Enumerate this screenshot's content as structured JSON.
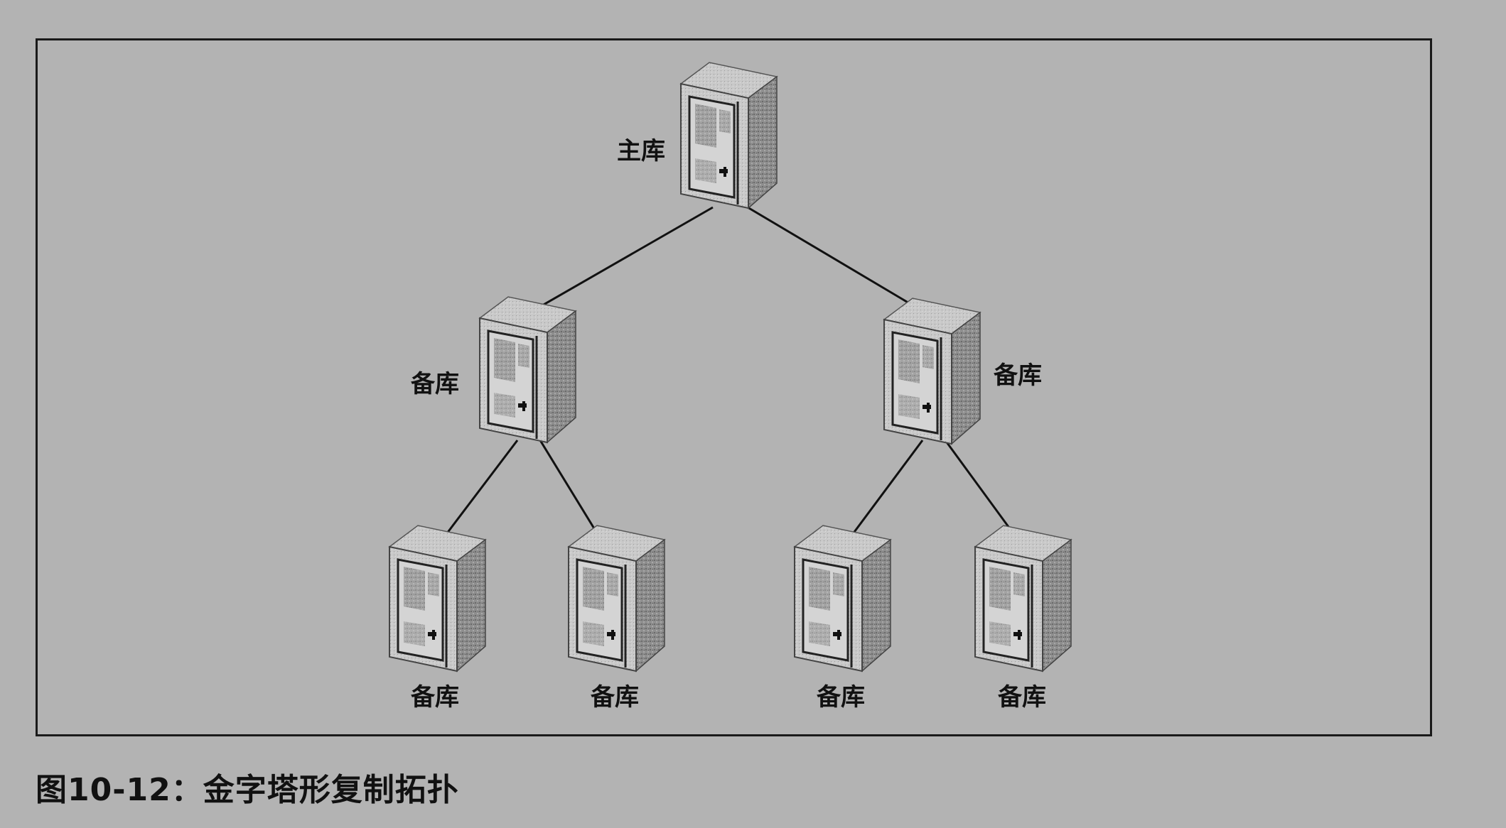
{
  "nodes": {
    "master": {
      "label": "主库"
    },
    "replica_l1_left": {
      "label": "备库"
    },
    "replica_l1_right": {
      "label": "备库"
    },
    "replica_l2_1": {
      "label": "备库"
    },
    "replica_l2_2": {
      "label": "备库"
    },
    "replica_l2_3": {
      "label": "备库"
    },
    "replica_l2_4": {
      "label": "备库"
    }
  },
  "edges": [
    {
      "from": "master",
      "to": "replica_l1_left"
    },
    {
      "from": "master",
      "to": "replica_l1_right"
    },
    {
      "from": "replica_l1_left",
      "to": "replica_l2_1"
    },
    {
      "from": "replica_l1_left",
      "to": "replica_l2_2"
    },
    {
      "from": "replica_l1_right",
      "to": "replica_l2_3"
    },
    {
      "from": "replica_l1_right",
      "to": "replica_l2_4"
    }
  ],
  "caption": "图10-12：金字塔形复制拓扑"
}
